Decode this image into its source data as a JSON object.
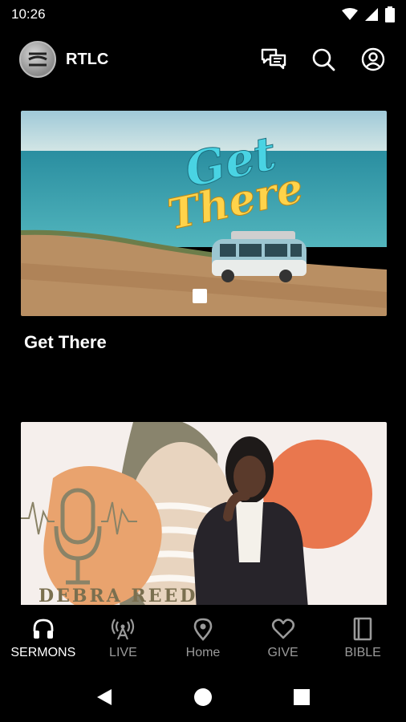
{
  "status": {
    "time": "10:26"
  },
  "app": {
    "title": "RTLC"
  },
  "cards": [
    {
      "title": "Get There",
      "art_text_line1": "Get",
      "art_text_line2": "There"
    },
    {
      "title": "",
      "art_text": "DEBRA REED"
    }
  ],
  "nav": [
    {
      "label": "SERMONS",
      "icon": "headphones-icon",
      "active": true
    },
    {
      "label": "LIVE",
      "icon": "broadcast-icon",
      "active": false
    },
    {
      "label": "Home",
      "icon": "location-pin-icon",
      "active": false
    },
    {
      "label": "GIVE",
      "icon": "heart-icon",
      "active": false
    },
    {
      "label": "BIBLE",
      "icon": "book-icon",
      "active": false
    }
  ],
  "colors": {
    "background": "#000000",
    "active_nav": "#ffffff",
    "inactive_nav": "#9a9a9a"
  }
}
